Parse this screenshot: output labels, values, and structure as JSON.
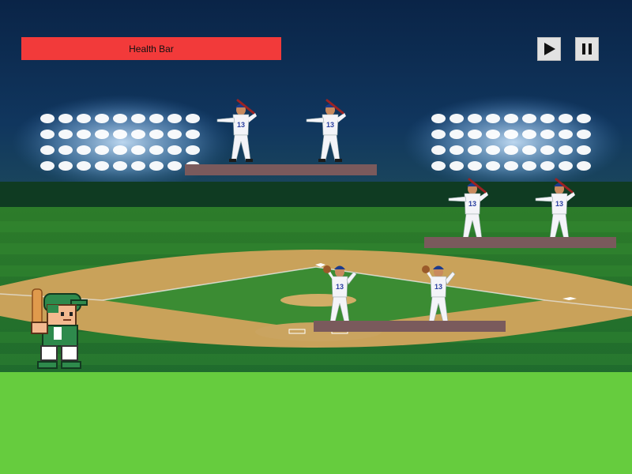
{
  "hud": {
    "health_label": "Health Bar",
    "play_icon": "play-icon",
    "pause_icon": "pause-icon"
  },
  "colors": {
    "health": "#f23a3a",
    "platform": "#7a5a5c",
    "ground": "#66cc3e",
    "sky": "#0c2a4e"
  },
  "enemies": [
    {
      "number": "13",
      "pose": "batter"
    },
    {
      "number": "13",
      "pose": "batter"
    },
    {
      "number": "13",
      "pose": "pitcher"
    },
    {
      "number": "13",
      "pose": "batter"
    },
    {
      "number": "13",
      "pose": "batter"
    },
    {
      "number": "13",
      "pose": "pitcher"
    }
  ]
}
